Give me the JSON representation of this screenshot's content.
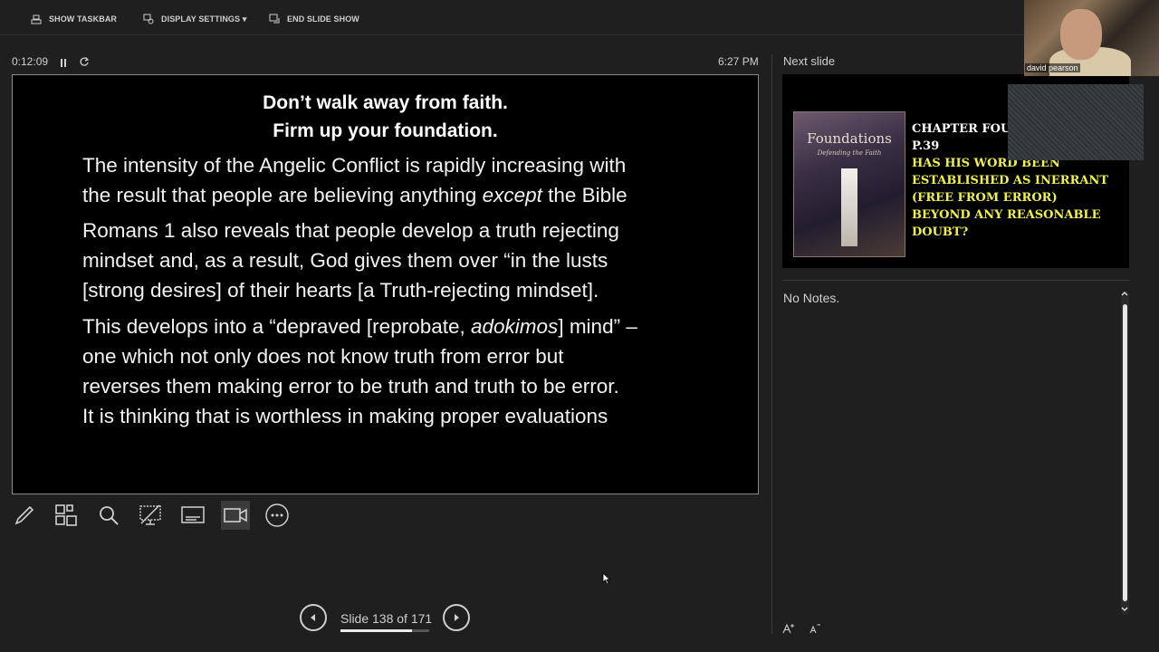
{
  "toolbar": {
    "show_taskbar": "SHOW TASKBAR",
    "display_settings": "DISPLAY SETTINGS ▾",
    "end_slide_show": "END SLIDE SHOW"
  },
  "presenter": {
    "elapsed_time": "0:12:09",
    "clock": "6:27 PM"
  },
  "current_slide": {
    "title_line1": "Don’t walk away from faith.",
    "title_line2": "Firm up your foundation.",
    "p1_line1": "The intensity of the Angelic Conflict is rapidly increasing with",
    "p1_line2_pre": "the result that people are believing anything ",
    "p1_line2_em": "except",
    "p1_line2_post": " the Bible",
    "p2_line1": "Romans 1 also reveals that people develop a truth rejecting",
    "p2_line2": "mindset and, as a result, God gives them over “in the lusts",
    "p2_line3": "[strong desires] of their hearts [a Truth-rejecting mindset].",
    "p3_line1_pre": "This develops into a “depraved [reprobate, ",
    "p3_line1_em": "adokimos",
    "p3_line1_post": "] mind” –",
    "p3_line2": "one which not only does not know truth from error but",
    "p3_line3": "reverses them making error to be truth and truth to be error.",
    "p3_line4": "It is thinking that is worthless in making proper evaluations"
  },
  "navigation": {
    "slide_counter": "Slide 138 of 171",
    "progress": 0.807
  },
  "next_slide": {
    "label": "Next slide",
    "book_title": "Foundations",
    "book_subtitle": "Defending the Faith",
    "line1": "CHAPTER FOUR",
    "line2": "P.39",
    "line3": "HAS HIS WORD BEEN",
    "line4": "ESTABLISHED AS INERRANT",
    "line5": "(FREE FROM ERROR)",
    "line6": "BEYOND ANY REASONABLE",
    "line7": "DOUBT?",
    "accent_color": "#f1f14a"
  },
  "notes": {
    "text": "No Notes."
  },
  "webcam": {
    "participant_name": "david pearson"
  }
}
